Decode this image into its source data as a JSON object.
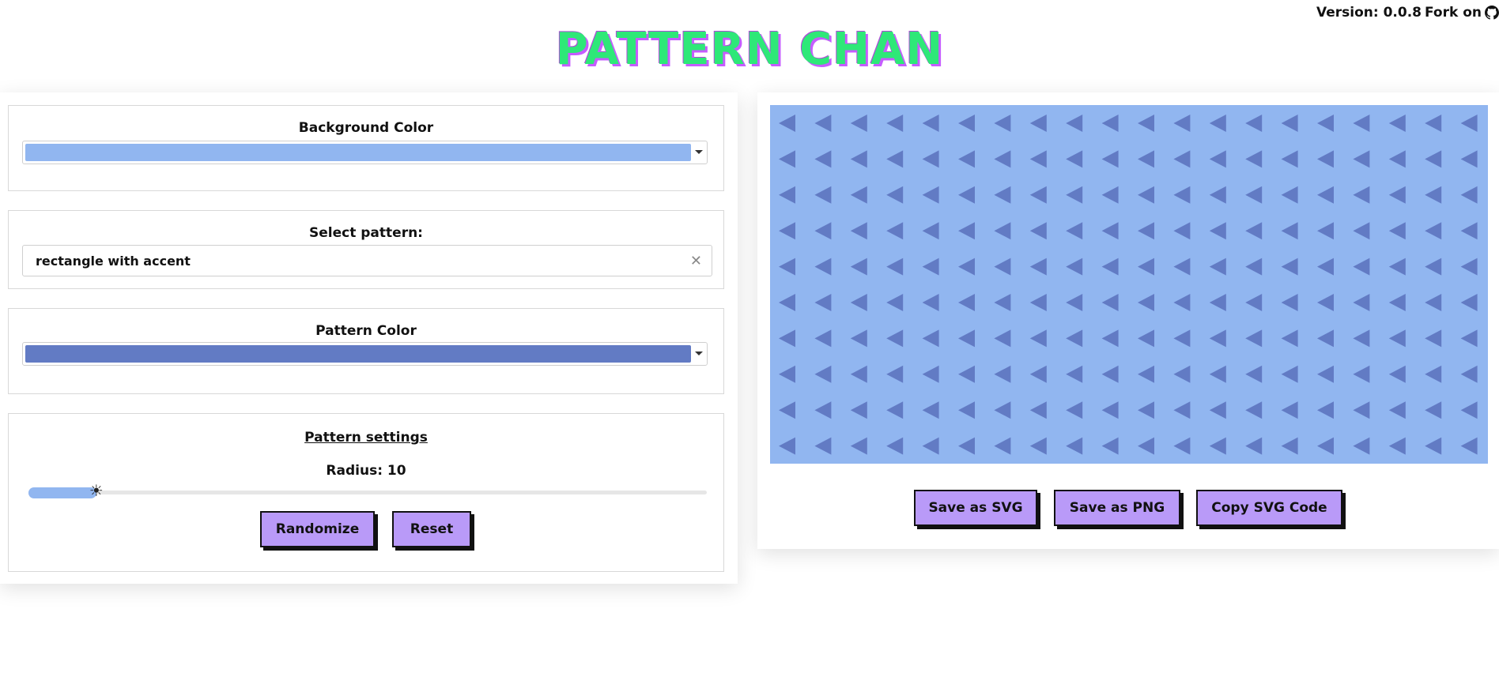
{
  "header": {
    "version_text": "Version: 0.0.8",
    "fork_text": "Fork on",
    "title": "PATTERN CHAN"
  },
  "controls": {
    "background_color": {
      "label": "Background Color",
      "value": "#91b6f0"
    },
    "pattern_select": {
      "label": "Select pattern:",
      "value": "rectangle with accent",
      "clear_icon": "close-icon"
    },
    "pattern_color": {
      "label": "Pattern Color",
      "value": "#627bc4"
    },
    "settings": {
      "title": "Pattern settings",
      "radius_label": "Radius: 10",
      "radius_value": 10,
      "radius_fraction": 0.1,
      "thumb_icon": "sun-icon",
      "randomize_label": "Randomize",
      "reset_label": "Reset"
    }
  },
  "preview": {
    "background": "#91b6f0",
    "pattern_color": "#627bc4",
    "shape": "left-pointing triangle",
    "actions": {
      "save_svg": "Save as SVG",
      "save_png": "Save as PNG",
      "copy_svg": "Copy SVG Code"
    }
  },
  "colors": {
    "accent_button": "#b99af8",
    "title_green": "#2ee878",
    "title_shadow": "#c65cff"
  }
}
